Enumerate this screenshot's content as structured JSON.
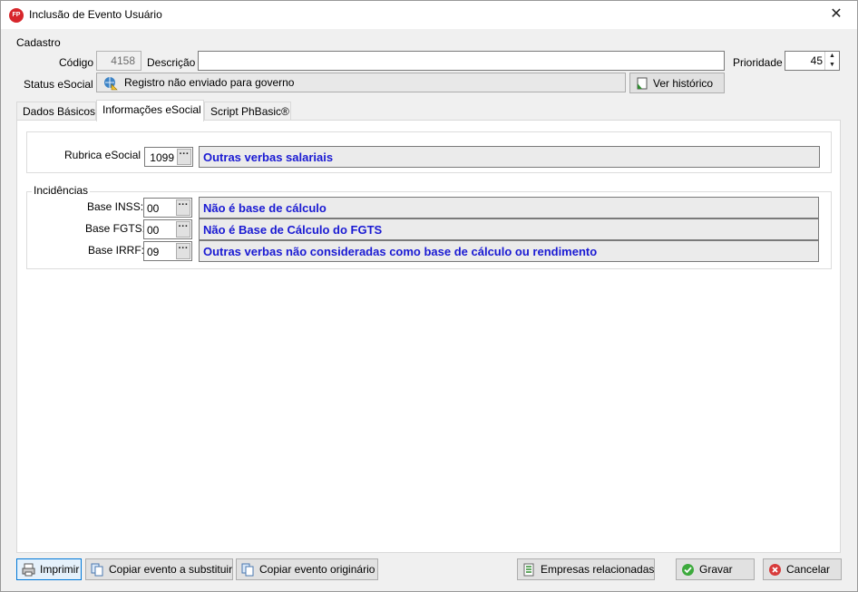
{
  "window": {
    "title": "Inclusão de Evento Usuário",
    "icon_text": "FP"
  },
  "cadastro": {
    "group_title": "Cadastro",
    "codigo_label": "Código",
    "codigo_value": "4158",
    "descricao_label": "Descrição",
    "descricao_value": "",
    "prioridade_label": "Prioridade",
    "prioridade_value": "45",
    "status_label": "Status eSocial",
    "status_value": "Registro não enviado para governo",
    "historico_button": "Ver histórico"
  },
  "tabs": [
    {
      "label": "Dados Básicos"
    },
    {
      "label": "Informações eSocial"
    },
    {
      "label": "Script PhBasic®"
    }
  ],
  "rubrica": {
    "label": "Rubrica eSocial",
    "code": "1099",
    "description": "Outras verbas salariais"
  },
  "incidencias": {
    "group_title": "Incidências",
    "rows": [
      {
        "label": "Base INSS:",
        "code": "00",
        "description": "Não é base de cálculo"
      },
      {
        "label": "Base FGTS:",
        "code": "00",
        "description": "Não é Base de Cálculo do FGTS"
      },
      {
        "label": "Base IRRF:",
        "code": "09",
        "description": "Outras verbas não consideradas como base de cálculo ou rendimento"
      }
    ]
  },
  "buttons": {
    "imprimir": "Imprimir",
    "copiar_substituir": "Copiar evento a substituir",
    "copiar_originario": "Copiar evento originário",
    "empresas": "Empresas relacionadas",
    "gravar": "Gravar",
    "cancelar": "Cancelar"
  },
  "colors": {
    "accent_text": "#1a1ad3",
    "app_icon": "#d7262b"
  }
}
